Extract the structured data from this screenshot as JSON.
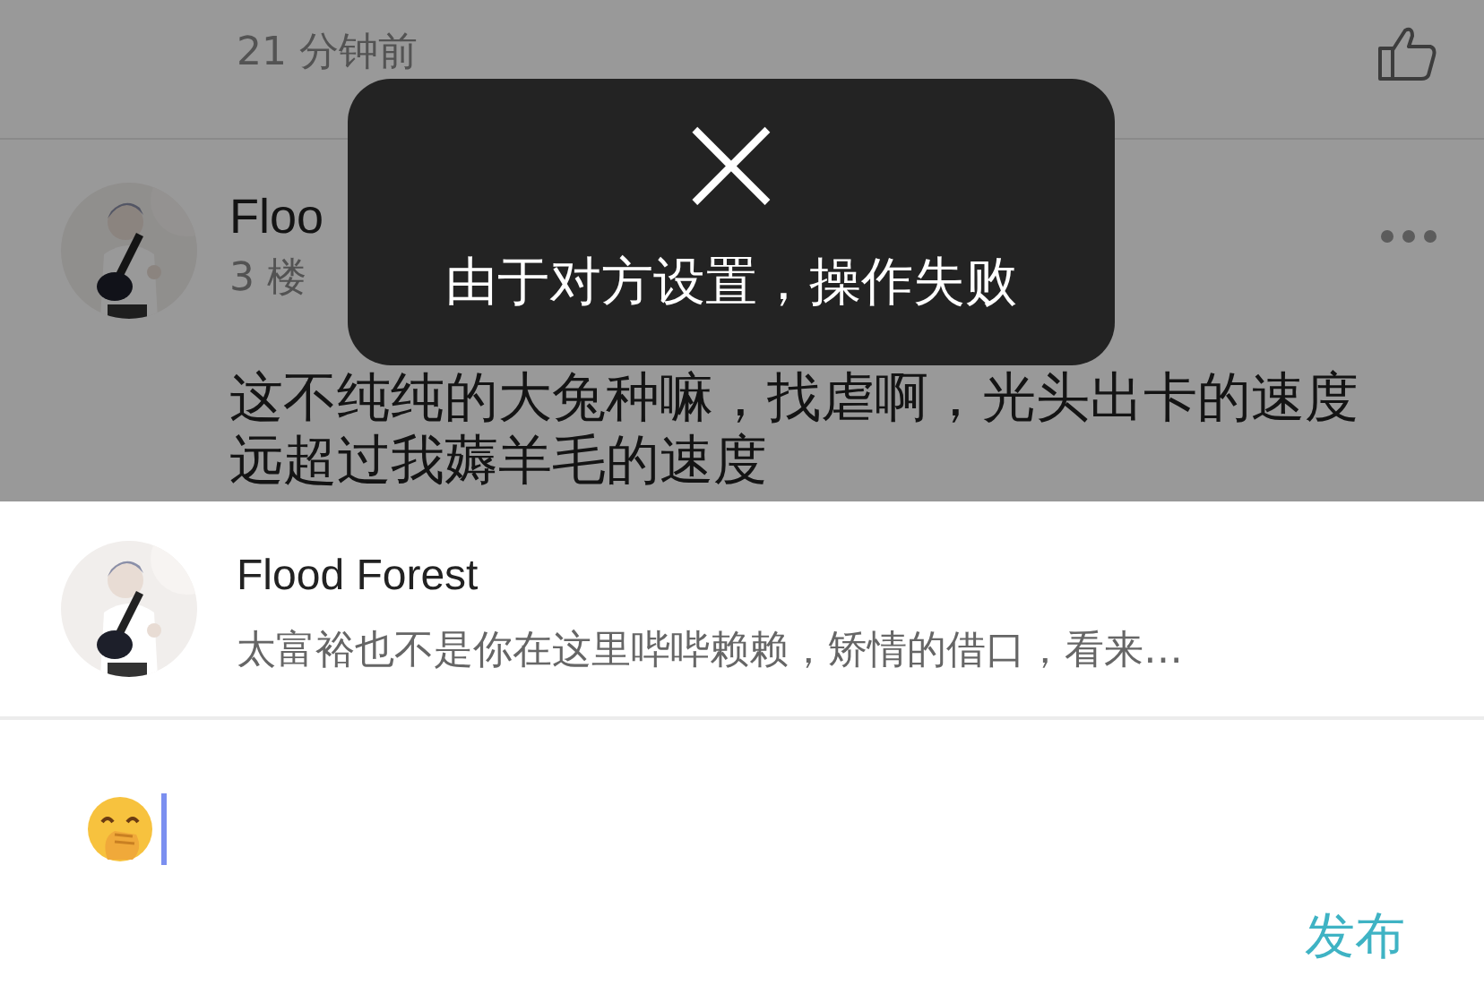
{
  "feed": {
    "dimmed": true,
    "previous_comment": {
      "time": "21 分钟前",
      "liked": false
    },
    "comment": {
      "author": "Floo",
      "floor": "3 楼",
      "text": "这不纯纯的大兔种嘛，找虐啊，光头出卡的速度远超过我薅羊毛的速度"
    }
  },
  "toast": {
    "icon": "×",
    "message": "由于对方设置，操作失败"
  },
  "reply_sheet": {
    "reply_to": {
      "author": "Flood Forest",
      "snippet": "太富裕也不是你在这里哔哔赖赖，矫情的借口，看来…"
    },
    "input": {
      "focused": true
    },
    "send_button": "发布"
  }
}
